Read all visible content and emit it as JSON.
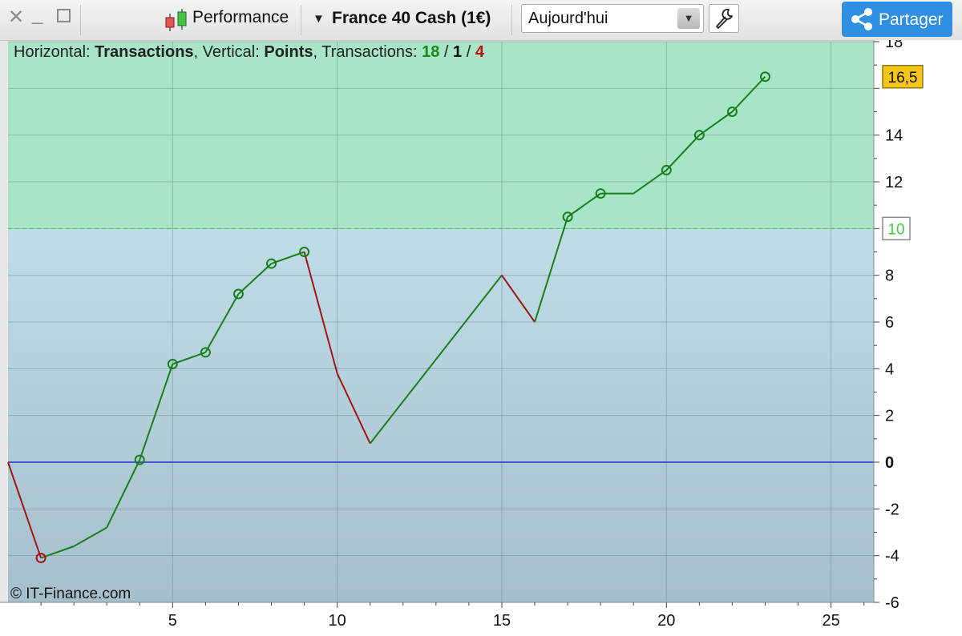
{
  "toolbar": {
    "close_icon": "close-icon",
    "minimize_icon": "minimize-icon",
    "maximize_icon": "maximize-icon",
    "performance_label": "Performance",
    "instrument_label": "France 40 Cash (1€)",
    "period_value": "Aujourd'hui",
    "settings_icon": "wrench-icon",
    "share_label": "Partager"
  },
  "summary": {
    "h_prefix": "Horizontal: ",
    "h_value": "Transactions",
    "v_prefix": ", Vertical: ",
    "v_value": "Points",
    "t_prefix": ", Transactions: ",
    "wins": "18",
    "sep1": " / ",
    "neutral": "1",
    "sep2": " / ",
    "losses": "4"
  },
  "copyright": "© IT-Finance.com",
  "colors": {
    "up": "#1a7f1a",
    "down": "#a31515",
    "zero_line": "#2233cc",
    "target_line": "#44cc44",
    "upper_zone": "#a8e4c8",
    "lower_zone_top": "#bfdce8",
    "lower_zone_bottom": "#a5c0cc"
  },
  "chart_data": {
    "type": "line",
    "xlabel": "",
    "ylabel": "",
    "xlim": [
      0,
      26.3
    ],
    "ylim": [
      -6,
      18
    ],
    "x_ticks": [
      5,
      10,
      15,
      20,
      25
    ],
    "y_ticks": [
      -6,
      -4,
      -2,
      0,
      2,
      4,
      6,
      8,
      10,
      12,
      14,
      16,
      18
    ],
    "y_tick_labels": [
      "-6",
      "-4",
      "-2",
      "0",
      "2",
      "4",
      "6",
      "8",
      "",
      "12",
      "14",
      "",
      "18"
    ],
    "grid": true,
    "target_level": 10,
    "target_label": "10",
    "last_value": 16.5,
    "last_value_label": "16,5",
    "points": [
      {
        "x": 0,
        "y": 0,
        "marker": false
      },
      {
        "x": 1,
        "y": -4.1,
        "marker": true
      },
      {
        "x": 2,
        "y": -3.6,
        "marker": false
      },
      {
        "x": 3,
        "y": -2.8,
        "marker": false
      },
      {
        "x": 4,
        "y": 0.1,
        "marker": true
      },
      {
        "x": 5,
        "y": 4.2,
        "marker": true
      },
      {
        "x": 6,
        "y": 4.7,
        "marker": true
      },
      {
        "x": 7,
        "y": 7.2,
        "marker": true
      },
      {
        "x": 8,
        "y": 8.5,
        "marker": true
      },
      {
        "x": 9,
        "y": 9.0,
        "marker": true
      },
      {
        "x": 10,
        "y": 3.8,
        "marker": false
      },
      {
        "x": 11,
        "y": 0.8,
        "marker": false
      },
      {
        "x": 15,
        "y": 8.0,
        "marker": false
      },
      {
        "x": 16,
        "y": 6.0,
        "marker": false
      },
      {
        "x": 17,
        "y": 10.5,
        "marker": true
      },
      {
        "x": 18,
        "y": 11.5,
        "marker": true
      },
      {
        "x": 19,
        "y": 11.5,
        "marker": false
      },
      {
        "x": 20,
        "y": 12.5,
        "marker": true
      },
      {
        "x": 21,
        "y": 14.0,
        "marker": true
      },
      {
        "x": 22,
        "y": 15.0,
        "marker": true
      },
      {
        "x": 23,
        "y": 16.5,
        "marker": true
      }
    ]
  }
}
